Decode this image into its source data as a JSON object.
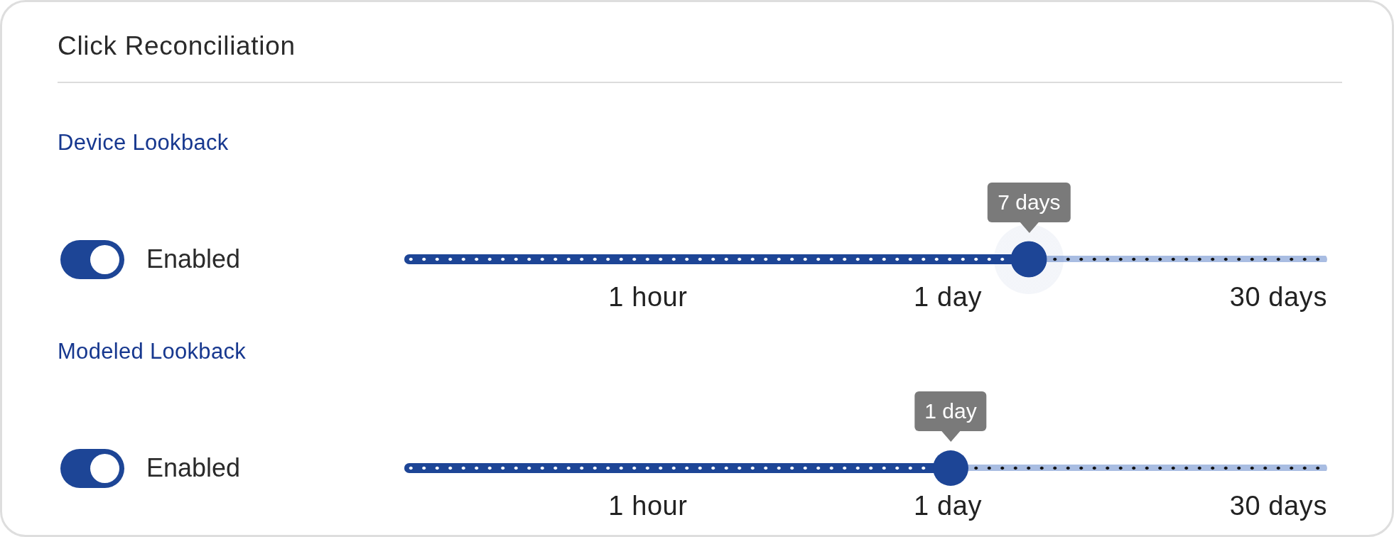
{
  "card": {
    "title": "Click Reconciliation"
  },
  "sections": [
    {
      "title": "Device Lookback",
      "toggle": {
        "on": true,
        "label": "Enabled"
      },
      "slider": {
        "level": 0.677,
        "focused": true,
        "value_label": "7 days",
        "marks": [
          "1 hour",
          "1 day",
          "30 days"
        ]
      }
    },
    {
      "title": "Modeled Lookback",
      "toggle": {
        "on": true,
        "label": "Enabled"
      },
      "slider": {
        "level": 0.592,
        "focused": false,
        "value_label": "1 day",
        "marks": [
          "1 hour",
          "1 day",
          "30 days"
        ]
      }
    }
  ]
}
